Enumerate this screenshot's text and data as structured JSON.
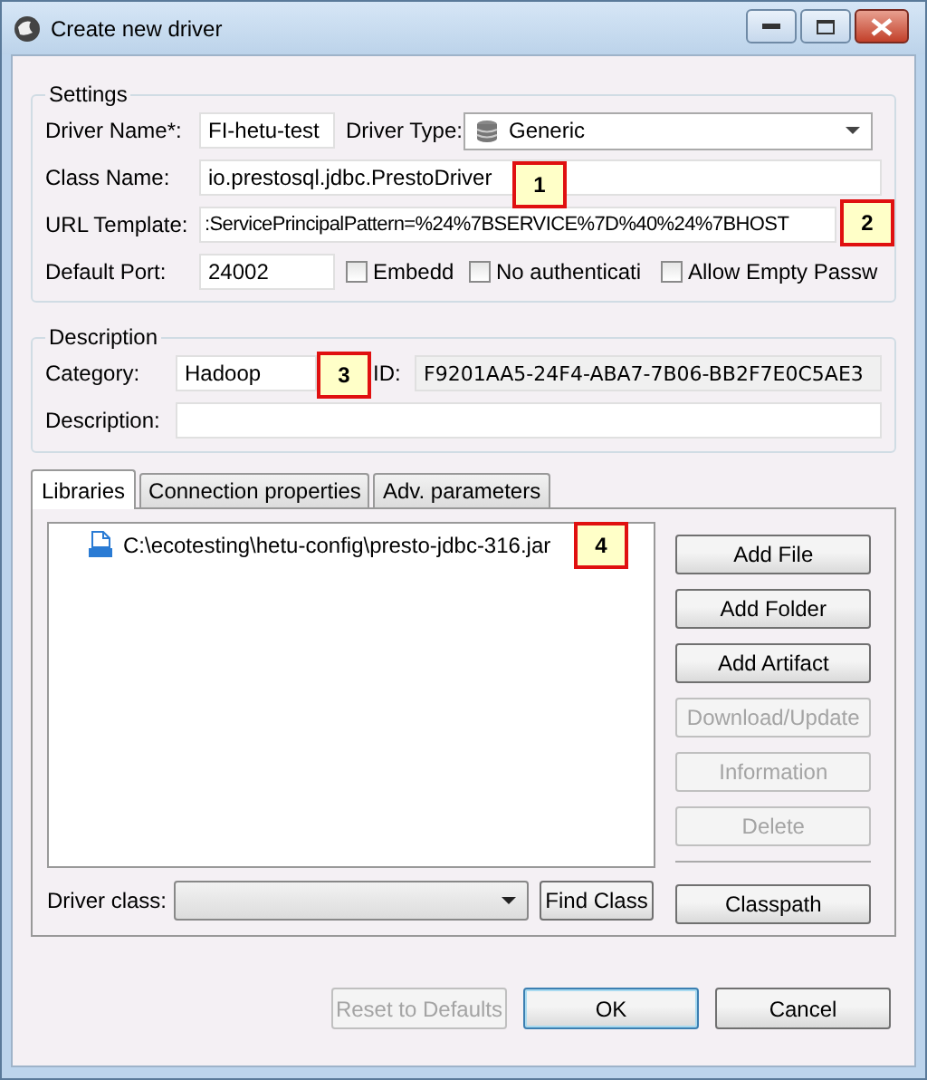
{
  "window": {
    "title": "Create new driver"
  },
  "settings": {
    "title": "Settings",
    "driver_name": {
      "label": "Driver Name*:",
      "value": "FI-hetu-test"
    },
    "driver_type": {
      "label": "Driver Type:",
      "value": "Generic"
    },
    "class_name": {
      "label": "Class Name:",
      "value": "io.prestosql.jdbc.PrestoDriver"
    },
    "url_template": {
      "label": "URL Template:",
      "value": ":ServicePrincipalPattern=%24%7BSERVICE%7D%40%24%7BHOST"
    },
    "default_port": {
      "label": "Default Port:",
      "value": "24002"
    },
    "options": [
      {
        "label": "Embedd",
        "checked": false
      },
      {
        "label": "No authenticati",
        "checked": false
      },
      {
        "label": "Allow Empty Passw",
        "checked": false
      }
    ]
  },
  "description": {
    "title": "Description",
    "category": {
      "label": "Category:",
      "value": "Hadoop"
    },
    "id": {
      "label": "ID:",
      "value": "F9201AA5-24F4-ABA7-7B06-BB2F7E0C5AE3"
    },
    "description": {
      "label": "Description:"
    }
  },
  "tabs": [
    {
      "label": "Libraries",
      "selected": true
    },
    {
      "label": "Connection properties",
      "selected": false
    },
    {
      "label": "Adv. parameters",
      "selected": false
    }
  ],
  "libraries": {
    "items": [
      {
        "path": "C:\\ecotesting\\hetu-config\\presto-jdbc-316.jar"
      }
    ],
    "buttons": [
      {
        "label": "Add File",
        "disabled": false
      },
      {
        "label": "Add Folder",
        "disabled": false
      },
      {
        "label": "Add Artifact",
        "disabled": false
      },
      {
        "label": "Download/Update",
        "disabled": true
      },
      {
        "label": "Information",
        "disabled": true
      },
      {
        "label": "Delete",
        "disabled": true
      }
    ],
    "classpath_button": "Classpath",
    "driver_class": {
      "label": "Driver class:"
    },
    "find_class_button": "Find Class"
  },
  "footer_buttons": [
    {
      "label": "Reset to Defaults",
      "disabled": true,
      "default": false
    },
    {
      "label": "OK",
      "disabled": false,
      "default": true
    },
    {
      "label": "Cancel",
      "disabled": false,
      "default": false
    }
  ],
  "callouts": [
    "1",
    "2",
    "3",
    "4"
  ]
}
